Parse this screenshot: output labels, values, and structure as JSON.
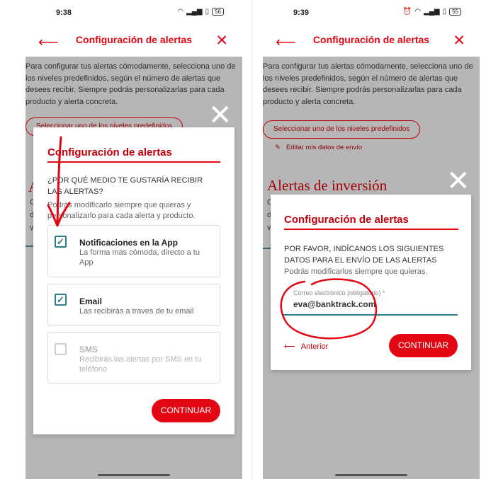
{
  "status_left": {
    "time": "9:38",
    "battery": "56"
  },
  "status_right": {
    "time": "9:39",
    "battery": "55"
  },
  "header": {
    "title": "Configuración de alertas",
    "back_icon": "arrow-left-icon",
    "close_icon": "close-icon"
  },
  "background": {
    "intro": "Para configurar tus alertas cómodamente, selecciona uno de los niveles predefinidos, según el número de alertas que desees recibir. Siempre podrás personalizarlas para cada producto y alerta concreta.",
    "preset_button": "Seleccionar uno de los niveles predefinidos",
    "edit_link": "Editar mis datos de envío",
    "section_heading": "Alertas de inversión"
  },
  "dialog_channel": {
    "title": "Configuración de alertas",
    "question": "¿POR QUÉ MEDIO TE GUSTARÍA RECIBIR LAS ALERTAS?",
    "hint": "Podrás modificarlo siempre que quieras y personalizarlo para cada alerta y producto.",
    "options": [
      {
        "title": "Notificaciones en la App",
        "desc": "La forma mas cómoda, directo a tu App",
        "checked": true
      },
      {
        "title": "Email",
        "desc": "Las recibirás a traves de tu email",
        "checked": true
      },
      {
        "title": "SMS",
        "desc": "Recibirás las alertas por SMS en tu teléfono",
        "checked": false
      }
    ],
    "continue": "CONTINUAR"
  },
  "dialog_email": {
    "title": "Configuración de alertas",
    "instruction": "POR FAVOR, INDÍCANOS LOS SIGUIENTES DATOS PARA EL ENVÍO DE LAS ALERTAS",
    "hint": "Podrás modificarlos siempre que quieras.",
    "field_label": "Correo electrónico (obligatorio) *",
    "field_value": "eva@banktrack.com",
    "previous": "Anterior",
    "continue": "CONTINUAR"
  },
  "colors": {
    "brand_red": "#e30613",
    "teal": "#2f7c8b",
    "overlay": "#b6b6b6"
  }
}
